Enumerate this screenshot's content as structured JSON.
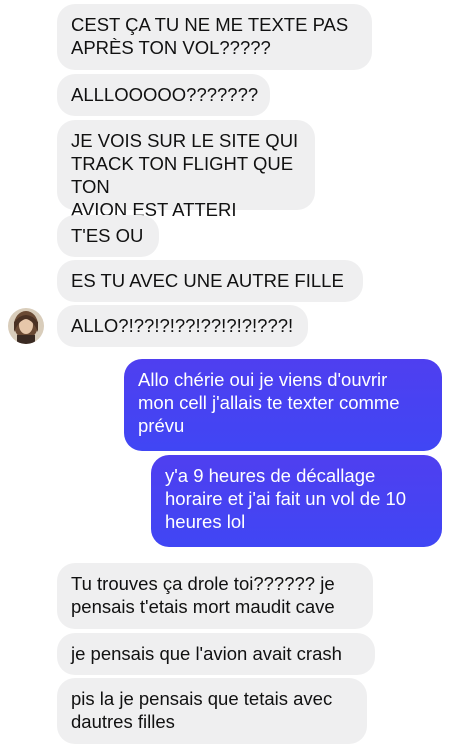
{
  "conversation": {
    "incoming_top": [
      "CEST ÇA TU NE ME TEXTE PAS\nAPRÈS TON VOL?????",
      "ALLLOOOOO???????",
      "JE VOIS SUR LE SITE QUI\nTRACK TON FLIGHT QUE TON\nAVION EST ATTERI",
      "T'ES OU",
      "ES TU AVEC UNE AUTRE FILLE",
      "ALLO?!??!?!??!??!?!?!???!"
    ],
    "outgoing": [
      "Allo chérie oui je viens d'ouvrir\nmon cell j'allais te texter comme\nprévu",
      "y'a 9 heures de décallage\nhoraire et j'ai fait un vol de 10\nheures lol"
    ],
    "incoming_bottom": [
      "Tu trouves ça drole toi?????? je\npensais t'etais mort maudit cave",
      "je pensais que l'avion avait crash",
      "pis la je pensais que tetais avec\ndautres filles"
    ]
  },
  "colors": {
    "incoming_bubble": "#efeff0",
    "outgoing_bubble": "#4646f2",
    "text_dark": "#111111",
    "text_light": "#ffffff"
  },
  "icons": {
    "contact_avatar": "contact-avatar-photo"
  }
}
